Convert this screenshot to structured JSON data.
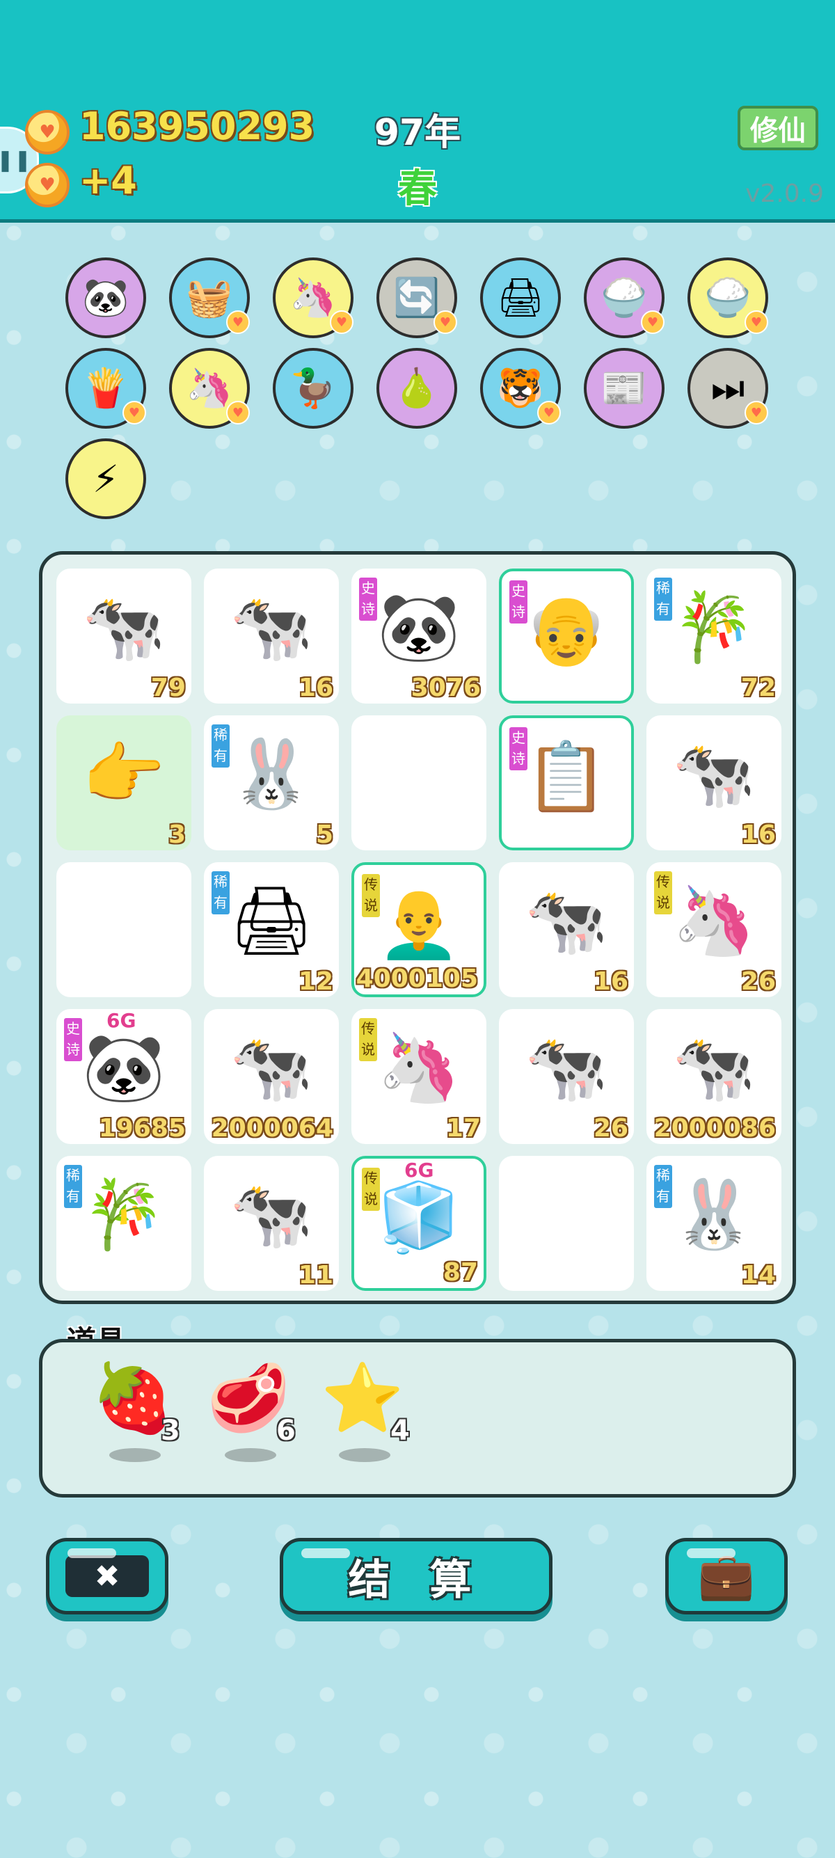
{
  "header": {
    "coins": "163950293",
    "coins_rate": "+4",
    "year": "97年",
    "season": "春",
    "xiuxian_label": "修仙",
    "version": "v2.0.9"
  },
  "skills": [
    {
      "icon": "panda-icon",
      "glyph": "🐼"
    },
    {
      "icon": "fruit-basket-icon",
      "glyph": "🧺"
    },
    {
      "icon": "unicorn-icon",
      "glyph": "🦄"
    },
    {
      "icon": "recycle-icon",
      "glyph": "🔄"
    },
    {
      "icon": "printer-icon",
      "glyph": "🖨"
    },
    {
      "icon": "rice-bowl-icon",
      "glyph": "🍚"
    },
    {
      "icon": "rice-bowl-icon",
      "glyph": "🍚"
    },
    {
      "icon": "fries-icon",
      "glyph": "🍟"
    },
    {
      "icon": "unicorn-icon",
      "glyph": "🦄"
    },
    {
      "icon": "duck-pot-icon",
      "glyph": "🦆"
    },
    {
      "icon": "guava-icon",
      "glyph": "🍐"
    },
    {
      "icon": "tiger-icon",
      "glyph": "🐯"
    },
    {
      "icon": "time-magazine-icon",
      "glyph": "📰"
    },
    {
      "icon": "next-icon",
      "glyph": "⏭"
    },
    {
      "icon": "lightning-icon",
      "glyph": "⚡"
    }
  ],
  "board": [
    {
      "glyph": "🐄",
      "tag": "",
      "num": "79"
    },
    {
      "glyph": "🐄",
      "tag": "",
      "num": "16"
    },
    {
      "glyph": "🐼",
      "tag": "史诗",
      "num": "3076"
    },
    {
      "glyph": "👴",
      "tag": "史诗",
      "num": ""
    },
    {
      "glyph": "🎋",
      "tag": "稀有",
      "num": "72"
    },
    {
      "glyph": "👉",
      "tag": "",
      "num": "3"
    },
    {
      "glyph": "🐰",
      "tag": "稀有",
      "num": "5"
    },
    {
      "glyph": "",
      "tag": "",
      "num": ""
    },
    {
      "glyph": "📋",
      "tag": "史诗",
      "num": ""
    },
    {
      "glyph": "🐄",
      "tag": "",
      "num": "16"
    },
    {
      "glyph": "",
      "tag": "",
      "num": ""
    },
    {
      "glyph": "🖨",
      "tag": "稀有",
      "num": "12"
    },
    {
      "glyph": "👨‍🦲",
      "tag": "传说",
      "num": "4000105"
    },
    {
      "glyph": "🐄",
      "tag": "",
      "num": "16"
    },
    {
      "glyph": "🦄",
      "tag": "传说",
      "num": "26"
    },
    {
      "glyph": "🐼",
      "tag": "史诗",
      "num": "19685",
      "badge": "6G"
    },
    {
      "glyph": "🐄",
      "tag": "",
      "num": "2000064"
    },
    {
      "glyph": "🦄",
      "tag": "传说",
      "num": "17"
    },
    {
      "glyph": "🐄",
      "tag": "",
      "num": "26"
    },
    {
      "glyph": "🐄",
      "tag": "",
      "num": "2000086"
    },
    {
      "glyph": "🎋",
      "tag": "稀有",
      "num": ""
    },
    {
      "glyph": "🐄",
      "tag": "",
      "num": "11"
    },
    {
      "glyph": "🧊",
      "tag": "传说",
      "num": "87",
      "badge": "6G"
    },
    {
      "glyph": "",
      "tag": "",
      "num": ""
    },
    {
      "glyph": "🐰",
      "tag": "稀有",
      "num": "14"
    }
  ],
  "props": {
    "title": "道具",
    "items": [
      {
        "icon": "lychee-icon",
        "glyph": "🍓",
        "count": "3"
      },
      {
        "icon": "liver-icon",
        "glyph": "🥩",
        "count": "6"
      },
      {
        "icon": "star-icon",
        "glyph": "⭐",
        "count": "4"
      }
    ]
  },
  "buttons": {
    "close_icon": "✖",
    "settle_label": "结 算",
    "bag_icon": "💼"
  },
  "colors": {
    "header": "#18c2c3",
    "background": "#b6e3ea",
    "highlight": "#2fcf9a",
    "epic": "#d94ed0",
    "rare": "#3aa2e0",
    "legend": "#e6d53a"
  }
}
